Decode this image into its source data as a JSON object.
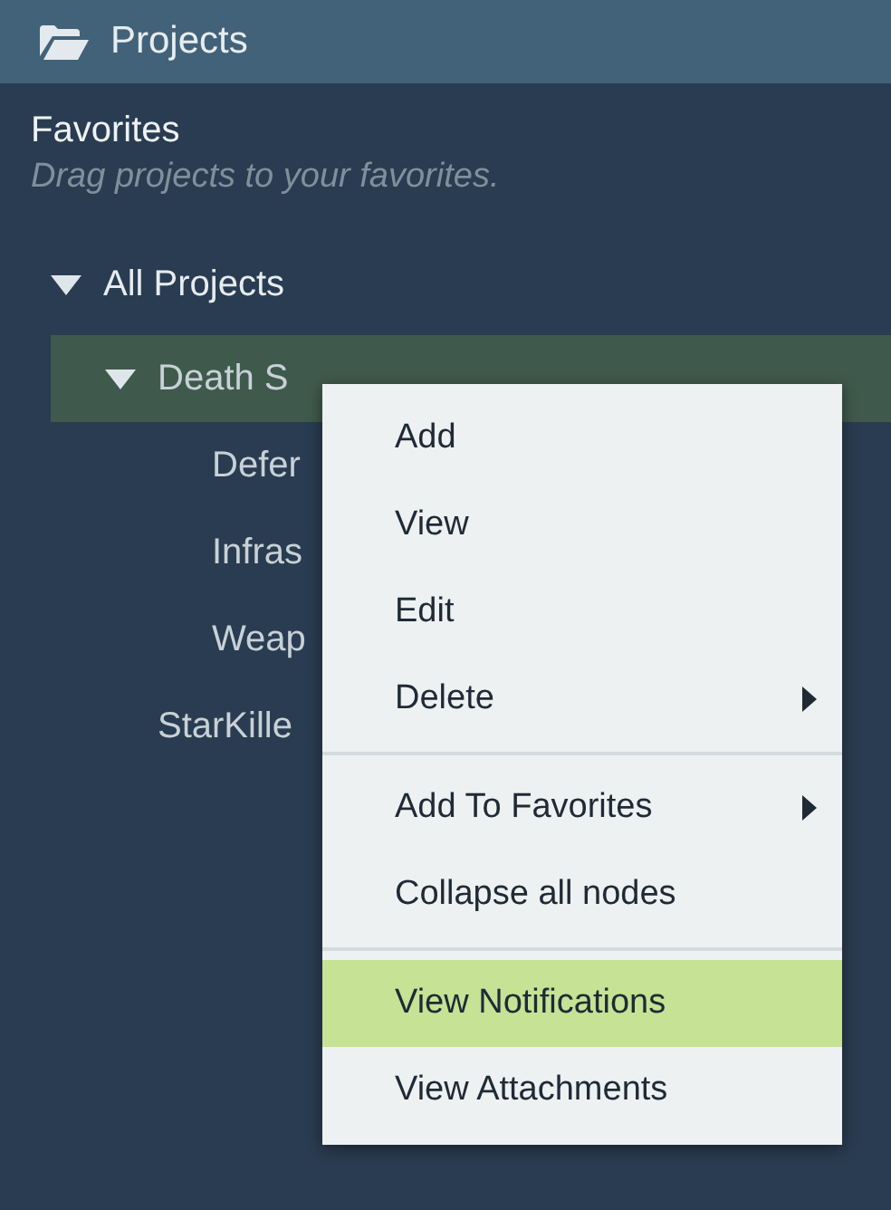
{
  "header": {
    "title": "Projects"
  },
  "favorites": {
    "title": "Favorites",
    "hint": "Drag projects to your favorites."
  },
  "tree": [
    {
      "label": "All Projects",
      "expanded": true,
      "selected": false,
      "children": [
        {
          "label": "Death S",
          "expanded": true,
          "selected": true,
          "children": [
            {
              "label": "Defer",
              "selected": false
            },
            {
              "label": "Infras",
              "selected": false
            },
            {
              "label": "Weap",
              "selected": false
            }
          ]
        },
        {
          "label": "StarKille",
          "selected": false
        }
      ]
    }
  ],
  "context_menu": {
    "groups": [
      [
        {
          "label": "Add",
          "selected": false,
          "submenu": false
        },
        {
          "label": "View",
          "selected": false,
          "submenu": false
        },
        {
          "label": "Edit",
          "selected": false,
          "submenu": false
        },
        {
          "label": "Delete",
          "selected": false,
          "submenu": true
        }
      ],
      [
        {
          "label": "Add To Favorites",
          "selected": false,
          "submenu": true
        },
        {
          "label": "Collapse all nodes",
          "selected": false,
          "submenu": false
        }
      ],
      [
        {
          "label": "View Notifications",
          "selected": true,
          "submenu": false
        },
        {
          "label": "View Attachments",
          "selected": false,
          "submenu": false
        }
      ]
    ]
  }
}
